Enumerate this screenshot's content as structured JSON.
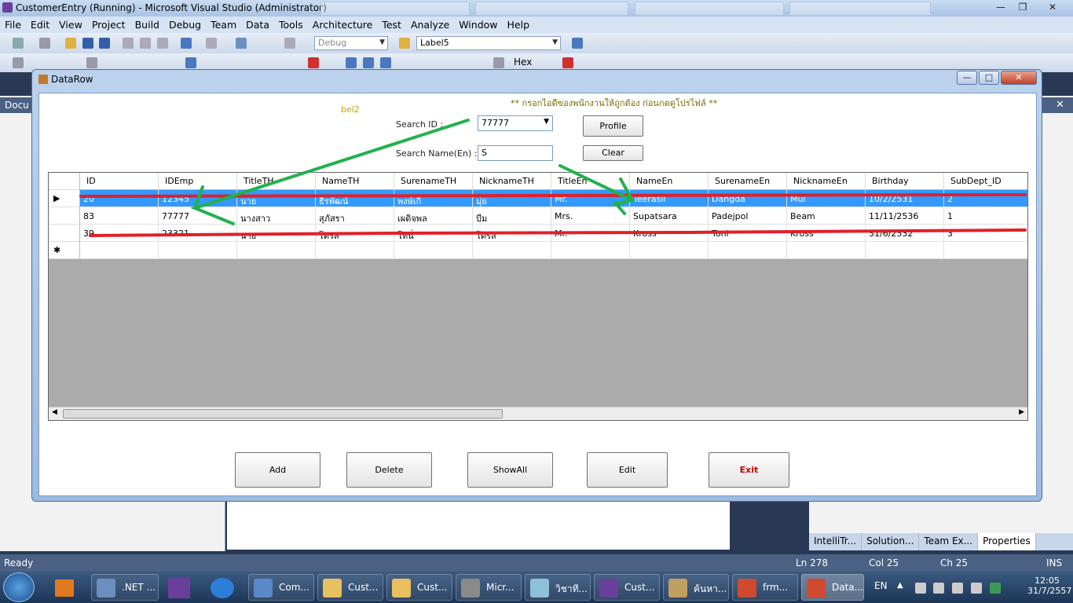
{
  "vs": {
    "title": "CustomerEntry (Running) - Microsoft Visual Studio (Administrator)",
    "menu": [
      "File",
      "Edit",
      "View",
      "Project",
      "Build",
      "Debug",
      "Team",
      "Data",
      "Tools",
      "Architecture",
      "Test",
      "Analyze",
      "Window",
      "Help"
    ],
    "config_combo": "Debug",
    "label_combo": "Label5",
    "hex_label": "Hex",
    "left_tab": "Docu",
    "bottom_tabs": [
      "IntelliTr...",
      "Solution...",
      "Team Ex...",
      "Properties"
    ],
    "status": {
      "ready": "Ready",
      "ln": "Ln 278",
      "col": "Col 25",
      "ch": "Ch 25",
      "ins": "INS"
    }
  },
  "window": {
    "title": "DataRow",
    "warning": "** กรอกไอดีของพนักงานให้ถูกต้อง ก่อนกดดูโปรไฟล์ **",
    "bel_label": "bel2",
    "search_id_label": "Search ID :",
    "search_id_value": "77777",
    "search_name_label": "Search Name(En) :",
    "search_name_value": "S",
    "profile_button": "Profile",
    "clear_button": "Clear",
    "grid": {
      "columns": [
        "ID",
        "IDEmp",
        "TitleTH",
        "NameTH",
        "SurenameTH",
        "NicknameTH",
        "TitleEn",
        "NameEn",
        "SurenameEn",
        "NicknameEn",
        "Birthday",
        "SubDept_ID"
      ],
      "rows": [
        [
          "20",
          "12345",
          "นาย",
          "ธีรพัฒน์",
          "พงษ์เกิ",
          "มุ่ย",
          "Mr.",
          "Teerasil",
          "Dangda",
          "Mui",
          "10/2/2531",
          "2"
        ],
        [
          "83",
          "77777",
          "นางสาว",
          "สุภัสรา",
          "เผดิจพล",
          "บีม",
          "Mrs.",
          "Supatsara",
          "Padejpol",
          "Beam",
          "11/11/2536",
          "1"
        ],
        [
          "39",
          "23321",
          "นาย",
          "โดรส",
          "โทนี่",
          "โดรส",
          "Mr.",
          "Kross",
          "Toni",
          "Kross",
          "31/6/2532",
          "3"
        ]
      ]
    },
    "buttons": {
      "add": "Add",
      "delete": "Delete",
      "showall": "ShowAll",
      "edit": "Edit",
      "exit": "Exit"
    }
  },
  "taskbar": {
    "items": [
      ".NET ...",
      "Com...",
      "Cust...",
      "Cust...",
      "Micr...",
      "วิชาที...",
      "Cust...",
      "ค้นหา...",
      "frm...",
      "Data..."
    ],
    "lang": "EN",
    "time": "12:05",
    "date": "31/7/2557"
  },
  "colors": {
    "selection": "#3399ff",
    "exit_text": "#cc0000",
    "annotation_green": "#22b14c",
    "annotation_red": "#e0202a"
  }
}
